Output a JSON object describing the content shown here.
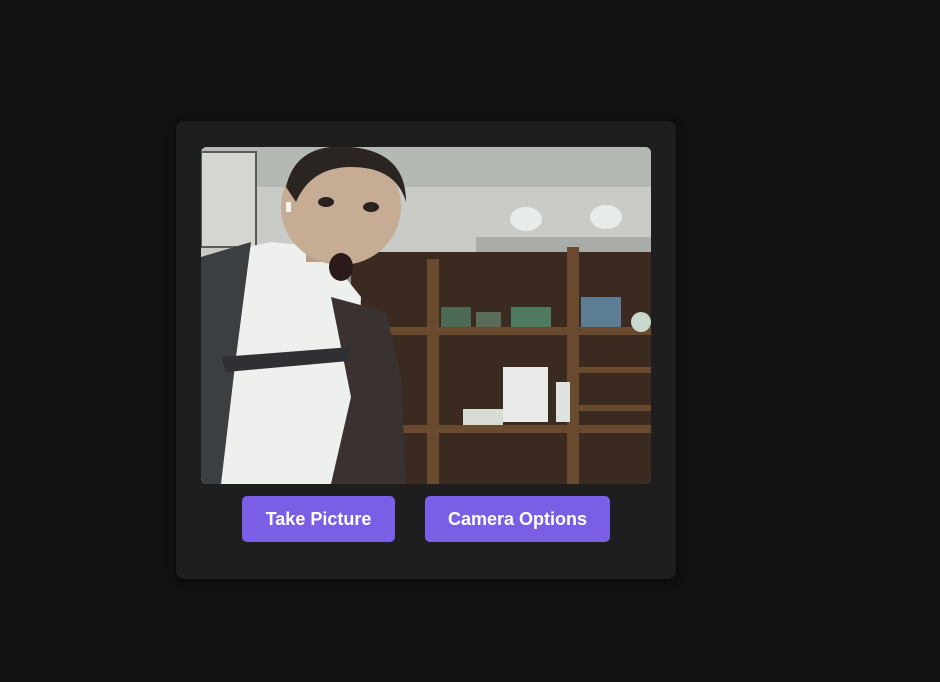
{
  "camera": {
    "buttons": {
      "take_picture_label": "Take Picture",
      "camera_options_label": "Camera Options"
    }
  },
  "colors": {
    "page_background": "#111111",
    "card_background": "#1e1e1e",
    "button_background": "#7a5fe6",
    "button_text": "#ffffff"
  }
}
